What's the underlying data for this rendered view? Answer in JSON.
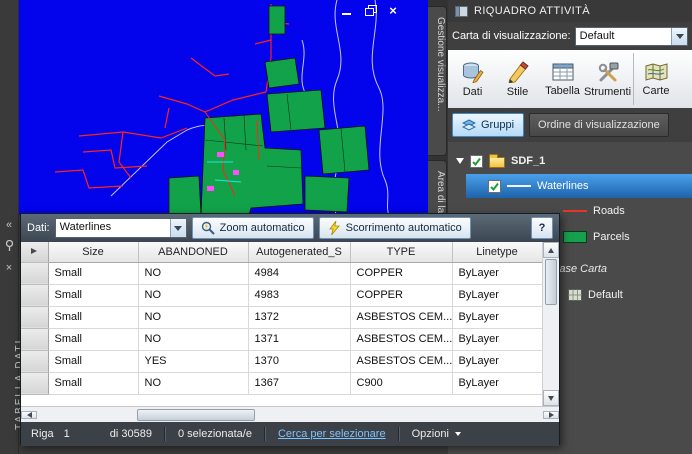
{
  "colors": {
    "map_background": "#0303ec",
    "parcel_green": "#12a34a",
    "road_red": "#ff2419",
    "selection_blue": "#2e7fd0",
    "active_tab_blue": "#b5daf7"
  },
  "left_strip": {
    "title": "TABELLA DATI",
    "icons": [
      "collapse-icon",
      "pin-icon",
      "close-icon"
    ]
  },
  "map": {
    "window_controls": [
      "minimize",
      "restore",
      "close"
    ]
  },
  "side_tabs": {
    "display_manager": "Gestione visualizza...",
    "workspace": "Area di lavoro"
  },
  "task_pane": {
    "title": "RIQUADRO ATTIVITÀ",
    "display_map_label": "Carta di visualizzazione:",
    "display_map_value": "Default",
    "toolbar": [
      {
        "label": "Dati",
        "icon": "data-icon"
      },
      {
        "label": "Stile",
        "icon": "style-icon"
      },
      {
        "label": "Tabella",
        "icon": "table-icon"
      },
      {
        "label": "Strumenti",
        "icon": "tools-icon"
      },
      {
        "label": "Carte",
        "icon": "maps-icon"
      }
    ],
    "tabs": {
      "gruppi": "Gruppi",
      "ordine": "Ordine di visualizzazione"
    },
    "tree": {
      "root_label": "SDF_1",
      "layers": [
        {
          "label": "Waterlines",
          "selected": true,
          "swatch": "line-white"
        },
        {
          "label": "Roads",
          "selected": false,
          "swatch": "line-red"
        },
        {
          "label": "Parcels",
          "selected": false,
          "swatch": "rect-green"
        }
      ],
      "base_section_label": "Base Carta",
      "base_item_label": "Default"
    }
  },
  "data_table": {
    "dati_label": "Dati:",
    "dati_value": "Waterlines",
    "zoom_button": "Zoom automatico",
    "scroll_button": "Scorrimento automatico",
    "help_button": "?",
    "columns": [
      "Size",
      "ABANDONED",
      "Autogenerated_S",
      "TYPE",
      "Linetype"
    ],
    "rows": [
      [
        "Small",
        "NO",
        "4984",
        "COPPER",
        "ByLayer"
      ],
      [
        "Small",
        "NO",
        "4983",
        "COPPER",
        "ByLayer"
      ],
      [
        "Small",
        "NO",
        "1372",
        "ASBESTOS CEM...",
        "ByLayer"
      ],
      [
        "Small",
        "NO",
        "1371",
        "ASBESTOS CEM...",
        "ByLayer"
      ],
      [
        "Small",
        "YES",
        "1370",
        "ASBESTOS CEM...",
        "ByLayer"
      ],
      [
        "Small",
        "NO",
        "1367",
        "C900",
        "ByLayer"
      ]
    ],
    "status": {
      "row_label": "Riga",
      "row_value": "1",
      "total_label": "di 30589",
      "selection_label": "0 selezionata/e",
      "search_link": "Cerca per selezionare",
      "options_label": "Opzioni"
    }
  }
}
